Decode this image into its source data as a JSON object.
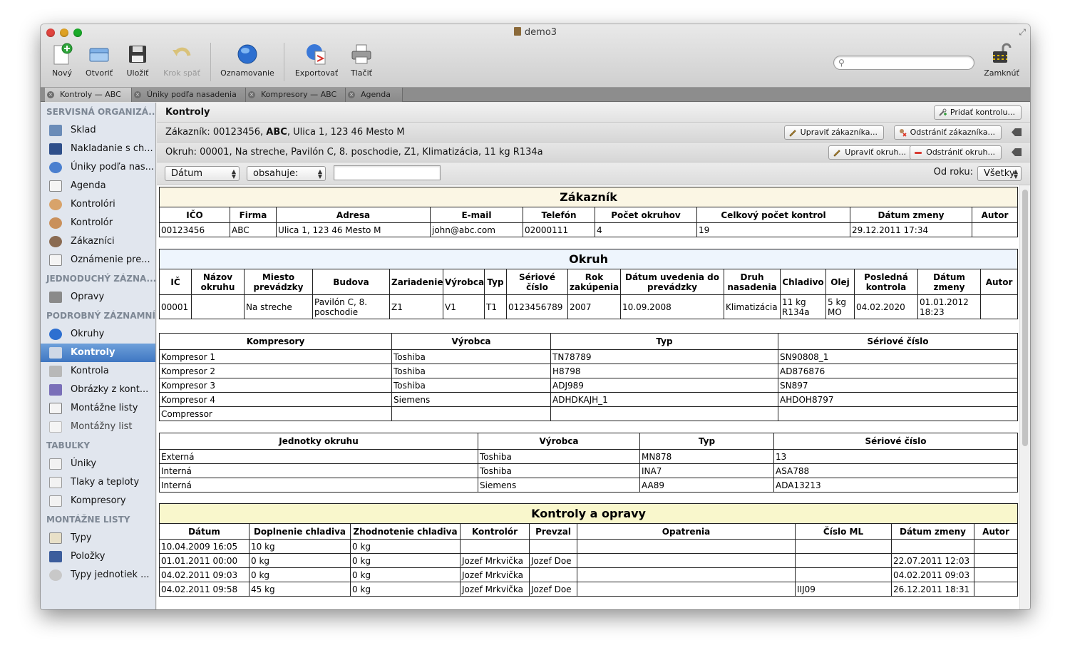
{
  "window": {
    "title": "demo3"
  },
  "toolbar": {
    "new": "Nový",
    "open": "Otvoriť",
    "save": "Uložiť",
    "undo": "Krok späť",
    "notify": "Oznamovanie",
    "export": "Exportovať",
    "print": "Tlačiť",
    "lock": "Zamknúť"
  },
  "tabs": [
    "Kontroly — ABC",
    "Úniky podľa nasadenia",
    "Kompresory — ABC",
    "Agenda"
  ],
  "sidebar": {
    "sections": [
      {
        "title": "SERVISNÁ ORGANIZÁ...",
        "items": [
          "Sklad",
          "Nakladanie s ch...",
          "Úniky podľa nas...",
          "Agenda",
          "Kontrolóri",
          "Kontrolór",
          "Zákazníci",
          "Oznámenie pre..."
        ]
      },
      {
        "title": "JEDNODUCHÝ ZÁZNA...",
        "items": [
          "Opravy"
        ]
      },
      {
        "title": "PODROBNÝ ZÁZNAMNÍK",
        "items": [
          "Okruhy",
          "Kontroly",
          "Kontrola",
          "Obrázky z kont...",
          "Montážne listy",
          "Montážny list"
        ]
      },
      {
        "title": "TABUĽKY",
        "items": [
          "Úniky",
          "Tlaky a teploty",
          "Kompresory"
        ]
      },
      {
        "title": "MONTÁŽNE LISTY",
        "items": [
          "Typy",
          "Položky",
          "Typy jednotiek ..."
        ]
      }
    ],
    "selected": "Kontroly"
  },
  "header": {
    "title": "Kontroly",
    "add_button": "Pridať kontrolu...",
    "customer_line_prefix": "Zákazník: 00123456, ",
    "customer_line_bold": "ABC",
    "customer_line_suffix": ", Ulica 1, 123 46 Mesto M",
    "edit_customer": "Upraviť zákazníka...",
    "remove_customer": "Odstrániť zákazníka...",
    "circuit_line": "Okruh: 00001, Na streche, Pavilón C, 8. poschodie, Z1, Klimatizácia, 11 kg R134a",
    "edit_circuit": "Upraviť okruh...",
    "remove_circuit": "Odstrániť okruh..."
  },
  "filter": {
    "field": "Dátum",
    "operator": "obsahuje:",
    "value": "",
    "year_label": "Od roku:",
    "year_value": "Všetky"
  },
  "customer_table": {
    "caption": "Zákazník",
    "headers": [
      "IČO",
      "Firma",
      "Adresa",
      "E-mail",
      "Telefón",
      "Počet okruhov",
      "Celkový počet kontrol",
      "Dátum zmeny",
      "Autor"
    ],
    "row": [
      "00123456",
      "ABC",
      "Ulica 1, 123 46 Mesto M",
      "john@abc.com",
      "02000111",
      "4",
      "19",
      "29.12.2011 17:34",
      ""
    ]
  },
  "circuit_table": {
    "caption": "Okruh",
    "headers": [
      "IČ",
      "Názov okruhu",
      "Miesto prevádzky",
      "Budova",
      "Zariadenie",
      "Výrobca",
      "Typ",
      "Sériové číslo",
      "Rok zakúpenia",
      "Dátum uvedenia do prevádzky",
      "Druh nasadenia",
      "Chladivo",
      "Olej",
      "Posledná kontrola",
      "Dátum zmeny",
      "Autor"
    ],
    "row": [
      "00001",
      "",
      "Na streche",
      "Pavilón C, 8. poschodie",
      "Z1",
      "V1",
      "T1",
      "0123456789",
      "2007",
      "10.09.2008",
      "Klimatizácia",
      "11 kg R134a",
      "5 kg MO",
      "04.02.2020",
      "01.01.2012 18:23",
      ""
    ]
  },
  "compressor_table": {
    "headers": [
      "Kompresory",
      "Výrobca",
      "Typ",
      "Sériové číslo"
    ],
    "rows": [
      [
        "Kompresor 1",
        "Toshiba",
        "TN78789",
        "SN90808_1"
      ],
      [
        "Kompresor 2",
        "Toshiba",
        "H8798",
        "AD876876"
      ],
      [
        "Kompresor 3",
        "Toshiba",
        "ADJ989",
        "SN897"
      ],
      [
        "Kompresor 4",
        "Siemens",
        "ADHDKAJH_1",
        "AHDOH8797"
      ],
      [
        "Compressor",
        "",
        "",
        ""
      ]
    ]
  },
  "unit_table": {
    "headers": [
      "Jednotky okruhu",
      "Výrobca",
      "Typ",
      "Sériové číslo"
    ],
    "rows": [
      [
        "Externá",
        "Toshiba",
        "MN878",
        "13"
      ],
      [
        "Interná",
        "Toshiba",
        "INA7",
        "ASA788"
      ],
      [
        "Interná",
        "Siemens",
        "AA89",
        "ADA13213"
      ]
    ]
  },
  "inspection_table": {
    "caption": "Kontroly a opravy",
    "headers": [
      "Dátum",
      "Doplnenie chladiva",
      "Zhodnotenie chladiva",
      "Kontrolór",
      "Prevzal",
      "Opatrenia",
      "Číslo ML",
      "Dátum zmeny",
      "Autor"
    ],
    "rows": [
      [
        "10.04.2009 16:05",
        "10 kg",
        "0 kg",
        "",
        "",
        "",
        "",
        "",
        ""
      ],
      [
        "01.01.2011 00:00",
        "0 kg",
        "0 kg",
        "Jozef Mrkvička",
        "Jozef Doe",
        "",
        "",
        "22.07.2011 12:03",
        ""
      ],
      [
        "04.02.2011 09:03",
        "0 kg",
        "0 kg",
        "Jozef Mrkvička",
        "",
        "",
        "",
        "04.02.2011 09:03",
        ""
      ],
      [
        "04.02.2011 09:58",
        "45 kg",
        "0 kg",
        "Jozef Mrkvička",
        "Jozef Doe",
        "",
        "IIJ09",
        "26.12.2011 18:31",
        ""
      ]
    ]
  }
}
